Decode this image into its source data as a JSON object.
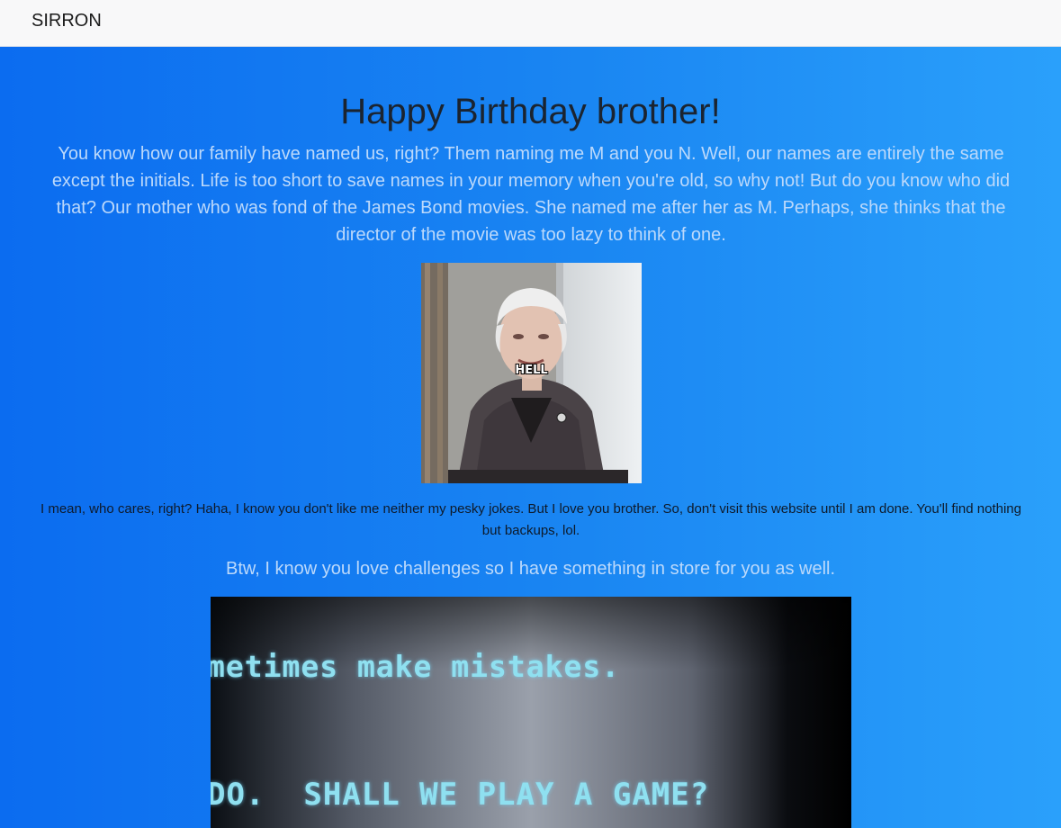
{
  "navbar": {
    "brand": "SIRRON"
  },
  "main": {
    "title": "Happy Birthday brother!",
    "intro": "You know how our family have named us, right? Them naming me M and you N. Well, our names are entirely the same except the initials. Life is too short to save names in your memory when you're old, so why not! But do you know who did that? Our mother who was fond of the James Bond movies. She named me after her as M. Perhaps, she thinks that the director of the movie was too lazy to think of one.",
    "gif1": {
      "caption": "HELL"
    },
    "paragraph2": "I mean, who cares, right? Haha, I know you don't like me neither my pesky jokes. But I love you brother. So, don't visit this website until I am done. You'll find nothing but backups, lol.",
    "paragraph3": "Btw, I know you love challenges so I have something in store for you as well.",
    "gif2": {
      "line1": "metimes make mistakes.",
      "line2": "DO.  SHALL WE PLAY A GAME?"
    }
  },
  "colors": {
    "navbar_bg": "#f8f8f9",
    "hero_left": "#0b6cf0",
    "hero_right": "#2aa0fb",
    "muted_text": "#bcd9fb"
  }
}
